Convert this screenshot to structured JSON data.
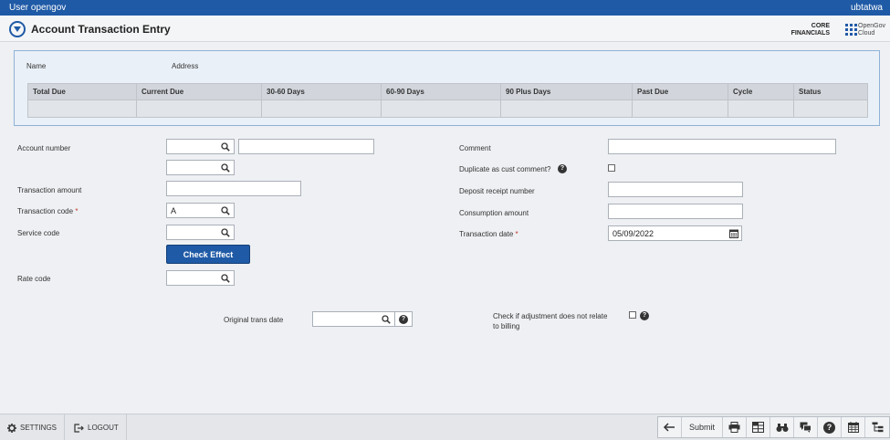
{
  "topbar": {
    "user": "User opengov",
    "site": "ubtatwa"
  },
  "header": {
    "title": "Account Transaction Entry",
    "product_line1": "CORE",
    "product_line2": "FINANCIALS",
    "cloud_line1": "OpenGov",
    "cloud_line2": "Cloud"
  },
  "summary": {
    "name_label": "Name",
    "address_label": "Address",
    "columns": [
      "Total Due",
      "Current Due",
      "30-60 Days",
      "60-90 Days",
      "90 Plus Days",
      "Past Due",
      "Cycle",
      "Status"
    ]
  },
  "form": {
    "account_number_label": "Account number",
    "transaction_amount_label": "Transaction amount",
    "transaction_code_label": "Transaction code",
    "transaction_code_value": "A",
    "service_code_label": "Service code",
    "check_effect_label": "Check Effect",
    "rate_code_label": "Rate code",
    "original_trans_date_label": "Original trans date",
    "comment_label": "Comment",
    "duplicate_label": "Duplicate as cust comment?",
    "deposit_receipt_label": "Deposit receipt number",
    "consumption_amount_label": "Consumption amount",
    "transaction_date_label": "Transaction date",
    "transaction_date_value": "05/09/2022",
    "adjustment_label_line1": "Check if adjustment does not relate",
    "adjustment_label_line2": "to billing",
    "required_mark": "*",
    "help_glyph": "?"
  },
  "footer": {
    "settings_label": "SETTINGS",
    "logout_label": "LOGOUT",
    "submit_label": "Submit"
  },
  "colors": {
    "brand": "#1f5aa6",
    "required": "#c0392b"
  }
}
